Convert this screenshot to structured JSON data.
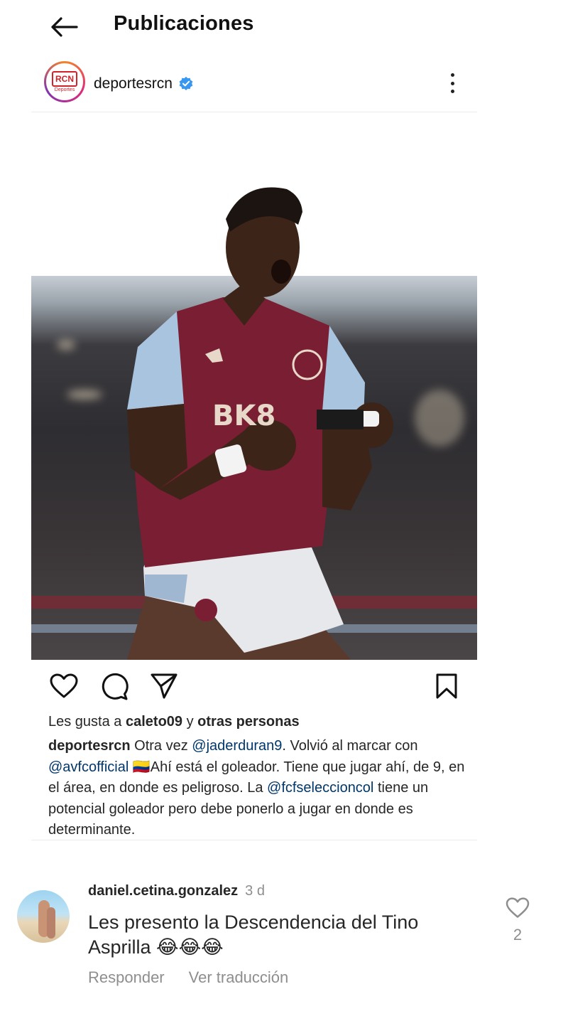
{
  "header": {
    "title": "Publicaciones",
    "back_icon": "arrow-left-icon"
  },
  "post": {
    "author": {
      "username": "deportesrcn",
      "verified": true,
      "avatar_logo_text": "RCN",
      "avatar_logo_sub": "Deportes"
    },
    "image_alt": "Jugador del Aston Villa celebrando un gol",
    "actions": {
      "like_icon": "heart-icon",
      "comment_icon": "comment-icon",
      "share_icon": "send-icon",
      "save_icon": "bookmark-icon"
    },
    "likes": {
      "prefix": "Les gusta a",
      "first_user": "caleto09",
      "connector": "y",
      "others": "otras personas"
    },
    "caption": {
      "username": "deportesrcn",
      "part1": "Otra vez",
      "mention1": "@jaderduran9",
      "part2": ". Volvió al marcar con",
      "mention2": "@avfcofficial",
      "flag": "🇨🇴",
      "part3": "Ahí está el goleador. Tiene que jugar ahí, de 9, en el área, en donde es peligroso. La",
      "mention3": "@fcfseleccioncol",
      "part4": "tiene un potencial goleador pero debe ponerlo a jugar en donde es determinante."
    }
  },
  "comment": {
    "username": "daniel.cetina.gonzalez",
    "time": "3 d",
    "text": "Les presento la Descendencia del Tino Asprilla 😂😂😂",
    "reply_label": "Responder",
    "translate_label": "Ver traducción",
    "like_count": "2"
  },
  "colors": {
    "text": "#262626",
    "secondary": "#8e8e8e",
    "mention": "#00376b",
    "verified": "#3897f0"
  }
}
